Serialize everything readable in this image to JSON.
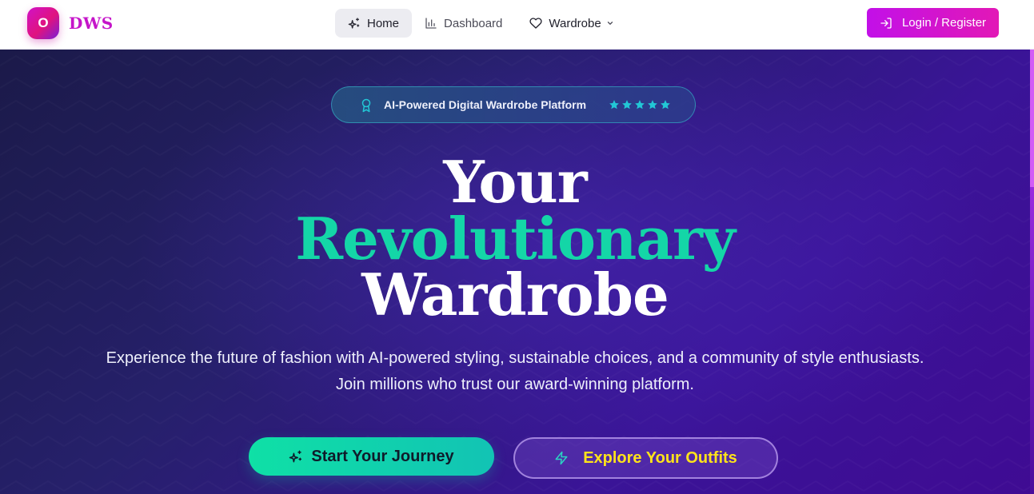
{
  "header": {
    "logo_letter": "O",
    "brand_name": "DWS",
    "nav": [
      {
        "label": "Home",
        "icon": "sparkles-icon",
        "active": true
      },
      {
        "label": "Dashboard",
        "icon": "bar-chart-icon",
        "active": false
      },
      {
        "label": "Wardrobe",
        "icon": "heart-icon",
        "active": false,
        "has_dropdown": true
      }
    ],
    "login_label": "Login / Register"
  },
  "hero": {
    "badge_text": "AI-Powered Digital Wardrobe Platform",
    "badge_icon": "award-icon",
    "rating_stars": 5,
    "headline_line1": "Your",
    "headline_line2": "Revolutionary",
    "headline_line3": "Wardrobe",
    "subtitle": "Experience the future of fashion with AI-powered styling, sustainable choices, and a community of style enthusiasts. Join millions who trust our award-winning platform.",
    "primary_cta": "Start Your Journey",
    "secondary_cta": "Explore Your Outfits"
  },
  "colors": {
    "brand": "#c515c9",
    "accent_teal": "#14d6a7",
    "accent_yellow": "#ffe31a",
    "hero_bg": "#2a1a7a"
  }
}
